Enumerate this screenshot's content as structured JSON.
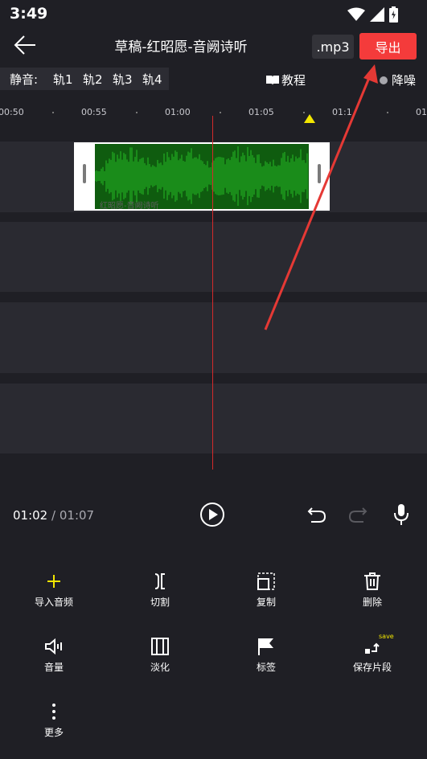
{
  "status": {
    "time": "3:49"
  },
  "header": {
    "title": "草稿-红昭愿-音阙诗听",
    "format": ".mp3",
    "export_label": "导出"
  },
  "mute": {
    "label": "静音:",
    "tracks": [
      "轨1",
      "轨2",
      "轨3",
      "轨4"
    ]
  },
  "links": {
    "tutorial": "教程",
    "denoise": "降噪"
  },
  "ruler": {
    "ticks": [
      "00:50",
      "00:55",
      "01:00",
      "01:05",
      "01:1",
      "01"
    ]
  },
  "clip": {
    "name": "红昭愿-音阙诗听",
    "wave_color": "#1fa11f"
  },
  "transport": {
    "current": "01:02",
    "separator": "/",
    "total": "01:07"
  },
  "tools": [
    {
      "label": "导入音频",
      "icon": "plus-icon"
    },
    {
      "label": "切割",
      "icon": "cut-icon"
    },
    {
      "label": "复制",
      "icon": "copy-icon"
    },
    {
      "label": "删除",
      "icon": "trash-icon"
    },
    {
      "label": "音量",
      "icon": "volume-icon"
    },
    {
      "label": "淡化",
      "icon": "fade-icon"
    },
    {
      "label": "标签",
      "icon": "flag-icon"
    },
    {
      "label": "保存片段",
      "icon": "save-segment-icon",
      "badge": "save"
    },
    {
      "label": "更多",
      "icon": "more-icon"
    }
  ],
  "colors": {
    "accent": "#f43b3b",
    "marker": "#f2e600",
    "background": "#1f1f25"
  }
}
